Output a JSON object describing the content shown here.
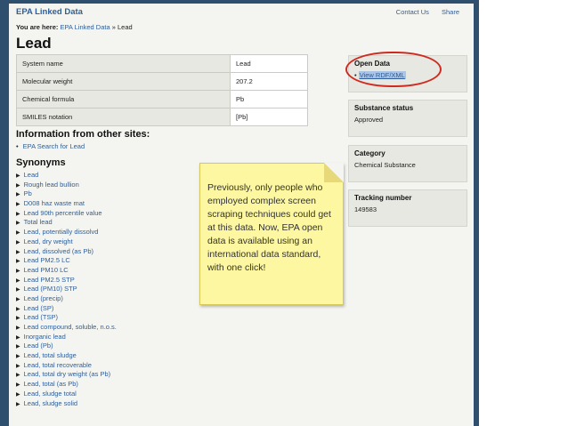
{
  "header": {
    "brand": "EPA Linked Data",
    "contact_label": "Contact Us",
    "share_label": "Share"
  },
  "breadcrumb": {
    "label": "You are here:",
    "crumb_1": "EPA Linked Data",
    "separator": "»",
    "crumb_2": "Lead"
  },
  "page_title": "Lead",
  "properties": [
    {
      "key": "System name",
      "value": "Lead"
    },
    {
      "key": "Molecular weight",
      "value": "207.2"
    },
    {
      "key": "Chemical formula",
      "value": "Pb"
    },
    {
      "key": "SMILES notation",
      "value": "[Pb]"
    }
  ],
  "other_sites": {
    "title": "Information from other sites:",
    "links": [
      "EPA Search for Lead"
    ]
  },
  "synonyms": {
    "title": "Synonyms",
    "items": [
      "Lead",
      "Rough lead bullion",
      "Pb",
      "D008 haz waste mat",
      "Lead 90th percentile value",
      "Total lead",
      "Lead, potentially dissolvd",
      "Lead, dry weight",
      "Lead, dissolved (as Pb)",
      "Lead PM2.5 LC",
      "Lead PM10 LC",
      "Lead PM2.5 STP",
      "Lead (PM10) STP",
      "Lead (precip)",
      "Lead (SP)",
      "Lead (TSP)",
      "Lead compound, soluble, n.o.s.",
      "Inorganic lead",
      "Lead (Pb)",
      "Lead, total sludge",
      "Lead, total recoverable",
      "Lead, total dry weight (as Pb)",
      "Lead, total (as Pb)",
      "Lead, sludge total",
      "Lead, sludge solid"
    ]
  },
  "sidebar": {
    "open_data": {
      "title": "Open Data",
      "link": "View RDF/XML"
    },
    "substance_status": {
      "title": "Substance status",
      "value": "Approved"
    },
    "category": {
      "title": "Category",
      "value": "Chemical Substance"
    },
    "tracking": {
      "title": "Tracking number",
      "value": "149583"
    }
  },
  "annotation_note": "Previously, only people who employed complex screen scraping techniques could get at this data. Now, EPA open data is available using an international data standard, with one click!",
  "colors": {
    "link": "#2f5e9a",
    "frame_bar": "#2f4f6e",
    "note": "#fcf7a0",
    "highlight_oval": "#d02a20"
  }
}
